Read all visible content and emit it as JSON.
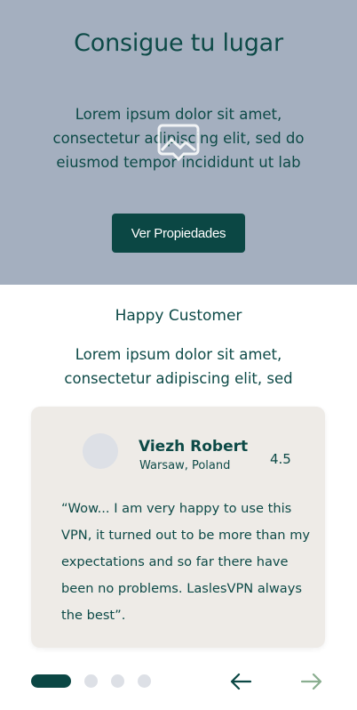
{
  "hero": {
    "title": "Consigue tu lugar",
    "description": "Lorem ipsum dolor sit amet, consectetur adipiscing elit, sed do eiusmod tempor incididunt ut lab",
    "cta_label": "Ver Propiedades",
    "background_color": "#a4afbf",
    "image_icon": "image-placeholder-icon"
  },
  "testimonials": {
    "title": "Happy Customer",
    "description": "Lorem ipsum dolor sit amet, consectetur adipiscing elit, sed",
    "card": {
      "name": "Viezh Robert",
      "location": "Warsaw, Poland",
      "rating": "4.5",
      "quote": "“Wow... I am very happy to use this VPN, it turned out to be more than my expectations and so far there have been no problems. LaslesVPN always the best”."
    },
    "pagination": {
      "pages": 4,
      "active_index": 0
    },
    "nav": {
      "prev_icon": "arrow-left-icon",
      "next_icon": "arrow-right-icon"
    }
  },
  "colors": {
    "primary": "#0b4744",
    "text": "#0d4a47",
    "card_background": "#eeebe7",
    "inactive_dot": "#dde0e6",
    "next_arrow": "#8aae90"
  }
}
